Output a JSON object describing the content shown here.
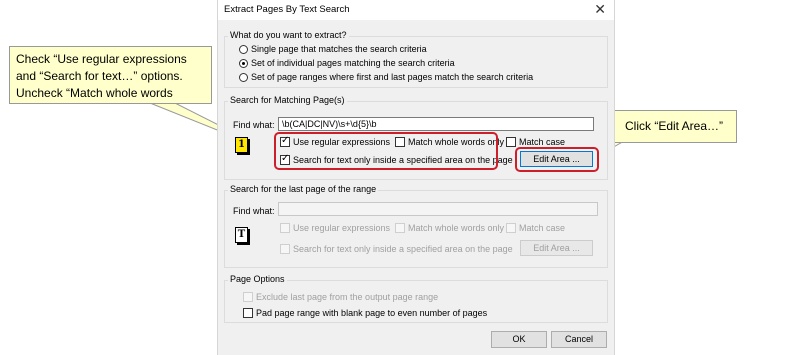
{
  "dialog": {
    "title": "Extract Pages By Text Search",
    "close_symbol": "✕",
    "extract": {
      "legend": "What do you want to extract?",
      "options": [
        {
          "label": "Single page that matches the search criteria",
          "selected": false
        },
        {
          "label": "Set of individual pages matching the search criteria",
          "selected": true
        },
        {
          "label": "Set of page ranges where first and last pages match the search criteria",
          "selected": false
        }
      ]
    },
    "search_matching": {
      "legend": "Search for Matching Page(s)",
      "find_label": "Find what:",
      "find_value": "\\b(CA|DC|NV)\\s+\\d{5}\\b",
      "icon_glyph": "1",
      "use_regex": {
        "label": "Use regular expressions",
        "checked": true
      },
      "match_whole": {
        "label": "Match whole words only",
        "checked": false
      },
      "match_case": {
        "label": "Match case",
        "checked": false
      },
      "search_area": {
        "label": "Search for text only inside a specified area on the page",
        "checked": true
      },
      "edit_area_label": "Edit Area ..."
    },
    "search_last": {
      "legend": "Search for the last page of the range",
      "find_label": "Find what:",
      "find_value": "",
      "icon_glyph": "T",
      "use_regex": {
        "label": "Use regular expressions",
        "checked": false
      },
      "match_whole": {
        "label": "Match whole words only",
        "checked": false
      },
      "match_case": {
        "label": "Match case",
        "checked": false
      },
      "search_area": {
        "label": "Search for text only inside a specified area on the page",
        "checked": false
      },
      "edit_area_label": "Edit Area ..."
    },
    "page_options": {
      "legend": "Page Options",
      "exclude_last": {
        "label": "Exclude last page from the output page range",
        "checked": false
      },
      "pad_range": {
        "label": "Pad page range with blank page to even number of pages",
        "checked": false
      }
    },
    "ok_label": "OK",
    "cancel_label": "Cancel"
  },
  "annotations": {
    "left_callout": [
      "Check “Use regular expressions",
      "and “Search for text…” options.",
      "Uncheck “Match whole words"
    ],
    "right_callout": "Click “Edit Area…”",
    "highlight_color": "#cc1f2a",
    "callout_fill": "#ffffcc"
  }
}
